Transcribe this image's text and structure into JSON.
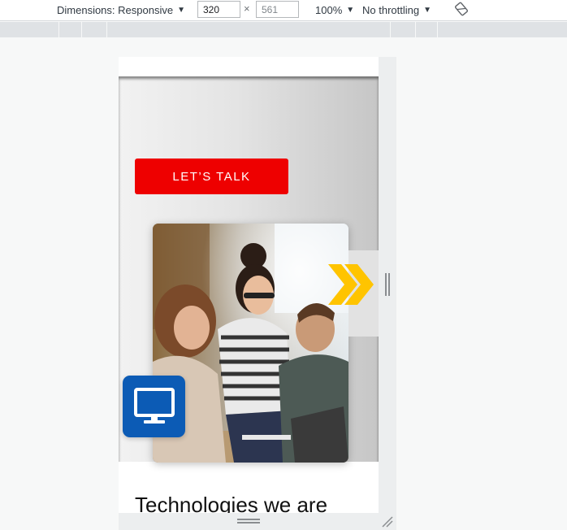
{
  "toolbar": {
    "dimensions_label": "Dimensions: Responsive",
    "width_value": "320",
    "times_symbol": "×",
    "height_placeholder": "561",
    "zoom_label": "100%",
    "throttling_label": "No throttling",
    "dropdown_caret": "▼",
    "rotate_icon": "rotate-icon"
  },
  "page": {
    "cta_label": "LET’S TALK",
    "photo_icon": "team-photo",
    "badge_icon": "monitor-icon",
    "badge_color": "#0c5bb5",
    "next_icon": "double-chevron-right-icon",
    "accent_red": "#ee0000",
    "accent_yellow": "#ffc400",
    "section_title": "Technologies we are"
  }
}
